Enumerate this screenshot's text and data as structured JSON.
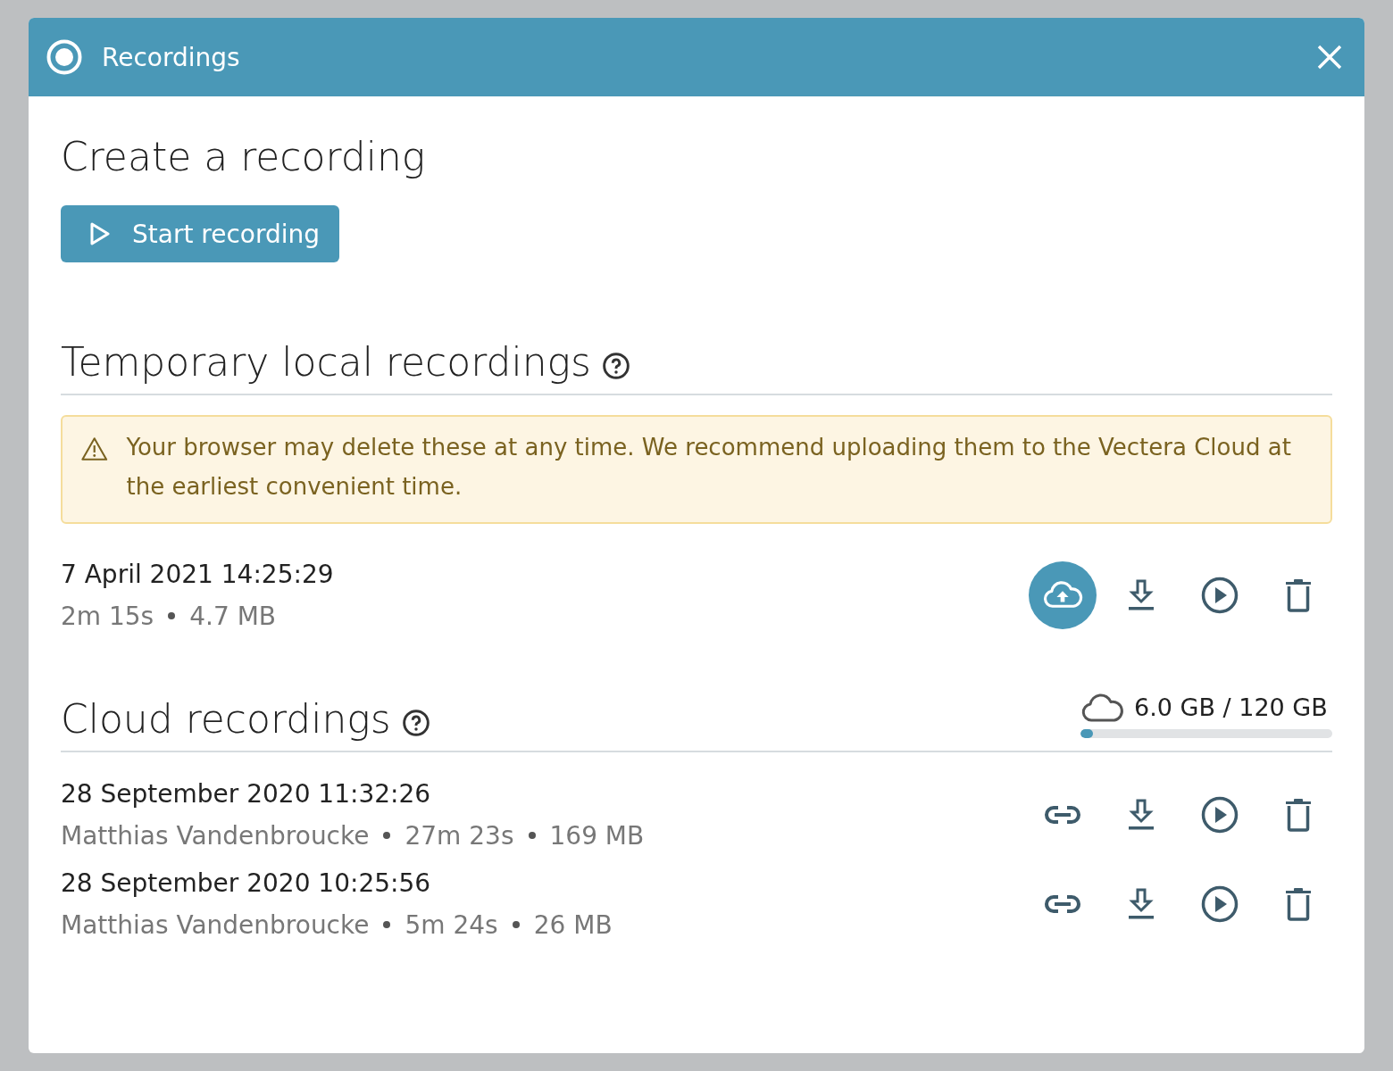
{
  "window": {
    "title": "Recordings"
  },
  "create": {
    "heading": "Create a recording",
    "button": "Start recording"
  },
  "local": {
    "heading": "Temporary local recordings",
    "warning": "Your browser may delete these at any time. We recommend uploading them to the Vectera Cloud at the earliest convenient time.",
    "recordings": [
      {
        "title": "7 April 2021 14:25:29",
        "details": [
          "2m 15s",
          "4.7 MB"
        ],
        "actions": [
          {
            "kind": "upload",
            "highlighted": true
          },
          {
            "kind": "download",
            "highlighted": false
          },
          {
            "kind": "play",
            "highlighted": false
          },
          {
            "kind": "delete",
            "highlighted": false
          }
        ]
      }
    ]
  },
  "cloud": {
    "heading": "Cloud recordings",
    "storage": {
      "reading": "6.0 GB / 120 GB",
      "level": 0.05
    },
    "recordings": [
      {
        "title": "28 September 2020 11:32:26",
        "details": [
          "Matthias Vandenbroucke",
          "27m 23s",
          "169 MB"
        ],
        "actions": [
          {
            "kind": "link",
            "highlighted": false
          },
          {
            "kind": "download",
            "highlighted": false
          },
          {
            "kind": "play",
            "highlighted": false
          },
          {
            "kind": "delete",
            "highlighted": false
          }
        ]
      },
      {
        "title": "28 September 2020 10:25:56",
        "details": [
          "Matthias Vandenbroucke",
          "5m 24s",
          "26 MB"
        ],
        "actions": [
          {
            "kind": "link",
            "highlighted": false
          },
          {
            "kind": "download",
            "highlighted": false
          },
          {
            "kind": "play",
            "highlighted": false
          },
          {
            "kind": "delete",
            "highlighted": false
          }
        ]
      }
    ]
  }
}
